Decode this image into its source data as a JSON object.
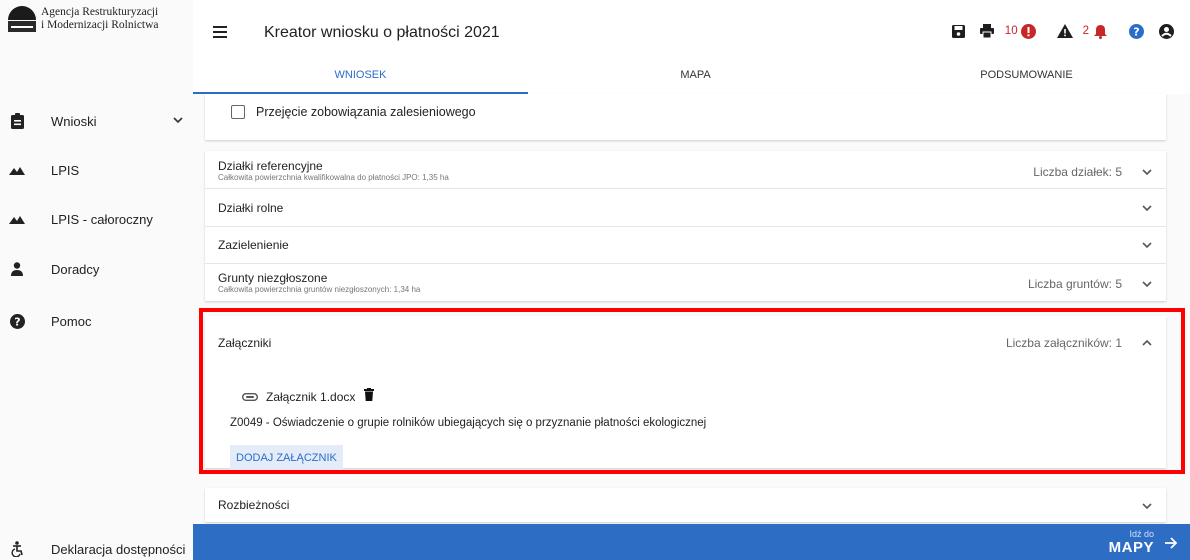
{
  "brand": {
    "line1": "Agencja Restrukturyzacji",
    "line2": "i Modernizacji Rolnictwa",
    "logo_caption": "ARiMR"
  },
  "sidebar": {
    "items": [
      {
        "label": "Wnioski",
        "icon": "clipboard-icon"
      },
      {
        "label": "LPIS",
        "icon": "mountains-icon"
      },
      {
        "label": "LPIS - całoroczny",
        "icon": "mountains-icon"
      },
      {
        "label": "Doradcy",
        "icon": "person-icon"
      },
      {
        "label": "Pomoc",
        "icon": "help-circle-icon"
      }
    ],
    "accessibility": {
      "label": "Deklaracja dostępności",
      "icon": "accessibility-icon"
    }
  },
  "header": {
    "title": "Kreator wniosku o płatności 2021",
    "errors_count": "10",
    "warnings_count": "2"
  },
  "tabs": [
    {
      "label": "WNIOSEK",
      "active": true
    },
    {
      "label": "MAPA",
      "active": false
    },
    {
      "label": "PODSUMOWANIE",
      "active": false
    }
  ],
  "checkbox": {
    "label": "Przejęcie zobowiązania zalesieniowego",
    "checked": false
  },
  "sections": {
    "dzialki_ref": {
      "title": "Działki referencyjne",
      "subtitle": "Całkowita powierzchnia kwalifikowalna do płatności JPO: 1,35 ha",
      "count": "Liczba działek: 5"
    },
    "dzialki_rolne": {
      "title": "Działki rolne"
    },
    "zazielenienie": {
      "title": "Zazielenienie"
    },
    "grunty": {
      "title": "Grunty niezgłoszone",
      "subtitle": "Całkowita powierzchnia gruntów niezgłoszonych: 1,34 ha",
      "count": "Liczba gruntów: 5"
    },
    "zalaczniki": {
      "title": "Załączniki",
      "count": "Liczba załączników: 1",
      "file_name": "Załącznik 1.docx",
      "description": "Z0049 - Oświadczenie o grupie rolników ubiegających się o przyznanie płatności ekologicznej",
      "add_button": "DODAJ ZAŁĄCZNIK"
    },
    "rozbieznosci": {
      "title": "Rozbieżności"
    }
  },
  "footer": {
    "small": "Idź do",
    "big": "MAPY"
  },
  "colors": {
    "accent": "#2d6dc4",
    "error": "#c62828",
    "highlight": "#ff0000"
  }
}
